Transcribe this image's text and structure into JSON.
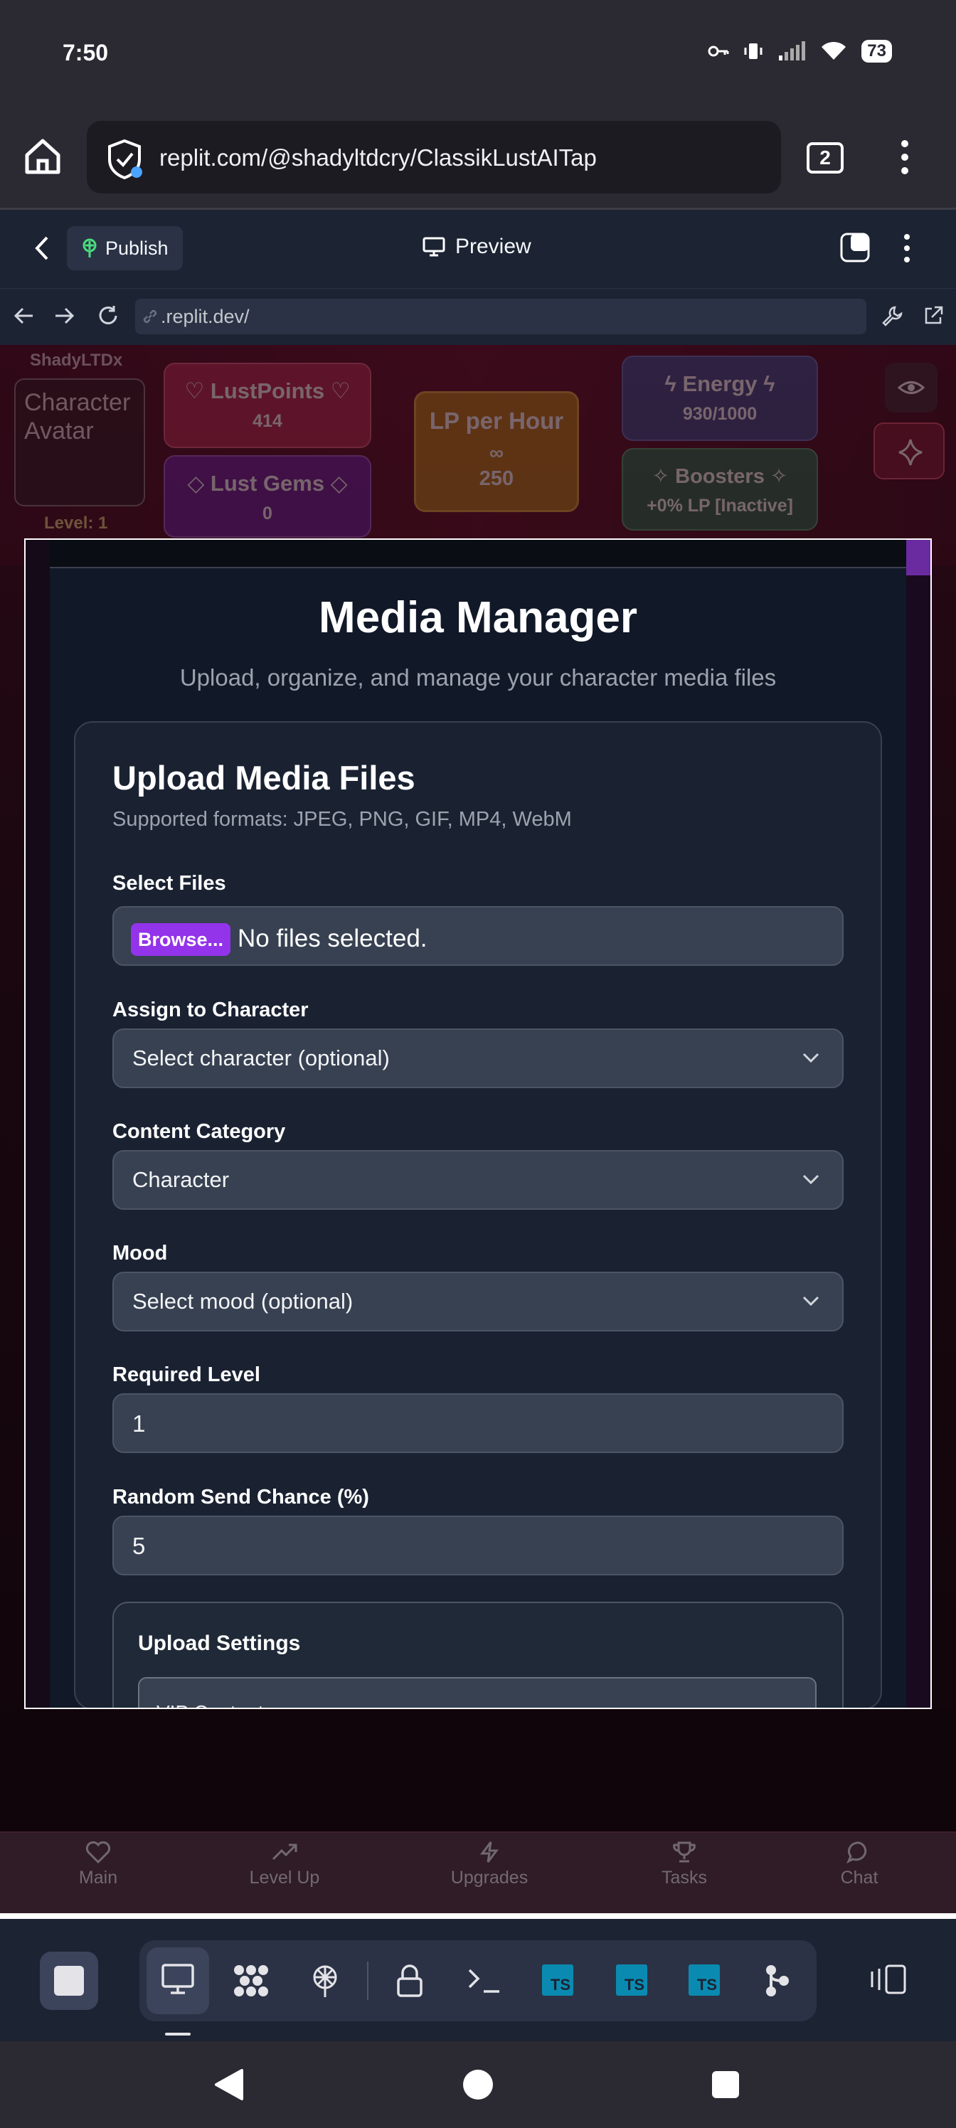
{
  "status_bar": {
    "time": "7:50",
    "battery": "73"
  },
  "browser": {
    "url": "replit.com/@shadyltdcry/ClassikLustAITap",
    "tab_count": "2"
  },
  "replit": {
    "publish_label": "Publish",
    "preview_label": "Preview",
    "address": ".replit.dev/"
  },
  "game": {
    "player_name": "ShadyLTDx",
    "avatar_text": "Character Avatar",
    "level_label": "Level: 1",
    "lustpoints": {
      "title": "LustPoints",
      "value": "414"
    },
    "gems": {
      "title": "Lust Gems",
      "value": "0"
    },
    "lp_per_hour": {
      "title": "LP per Hour",
      "value": "250",
      "symbol": "∞"
    },
    "energy": {
      "title": "Energy",
      "value": "930/1000"
    },
    "boosters": {
      "title": "Boosters",
      "value": "+0% LP [Inactive]"
    },
    "nav": [
      {
        "label": "Main",
        "icon": "heart-icon"
      },
      {
        "label": "Level Up",
        "icon": "trending-up-icon"
      },
      {
        "label": "Upgrades",
        "icon": "bolt-icon"
      },
      {
        "label": "Tasks",
        "icon": "trophy-icon"
      },
      {
        "label": "Chat",
        "icon": "chat-icon"
      }
    ]
  },
  "media_manager": {
    "title": "Media Manager",
    "subtitle": "Upload, organize, and manage your character media files",
    "upload": {
      "title": "Upload Media Files",
      "formats": "Supported formats: JPEG, PNG, GIF, MP4, WebM",
      "select_files_label": "Select Files",
      "browse_label": "Browse...",
      "file_status": "No files selected.",
      "character_label": "Assign to Character",
      "character_value": "Select character (optional)",
      "category_label": "Content Category",
      "category_value": "Character",
      "mood_label": "Mood",
      "mood_value": "Select mood (optional)",
      "level_label": "Required Level",
      "level_value": "1",
      "chance_label": "Random Send Chance (%)",
      "chance_value": "5",
      "settings_title": "Upload Settings",
      "settings_peek": "VIP Content"
    }
  },
  "toolbar": {
    "tools": [
      "preview-icon",
      "packages-icon",
      "deployments-icon",
      "secrets-icon",
      "shell-icon",
      "ts-file-icon",
      "ts-file-icon",
      "ts-file-icon",
      "git-icon"
    ],
    "ts_label": "TS"
  },
  "colors": {
    "accent": "#9333ea",
    "modal_bg": "#111827",
    "card_bg": "#1a2232",
    "input_bg": "#374151"
  }
}
